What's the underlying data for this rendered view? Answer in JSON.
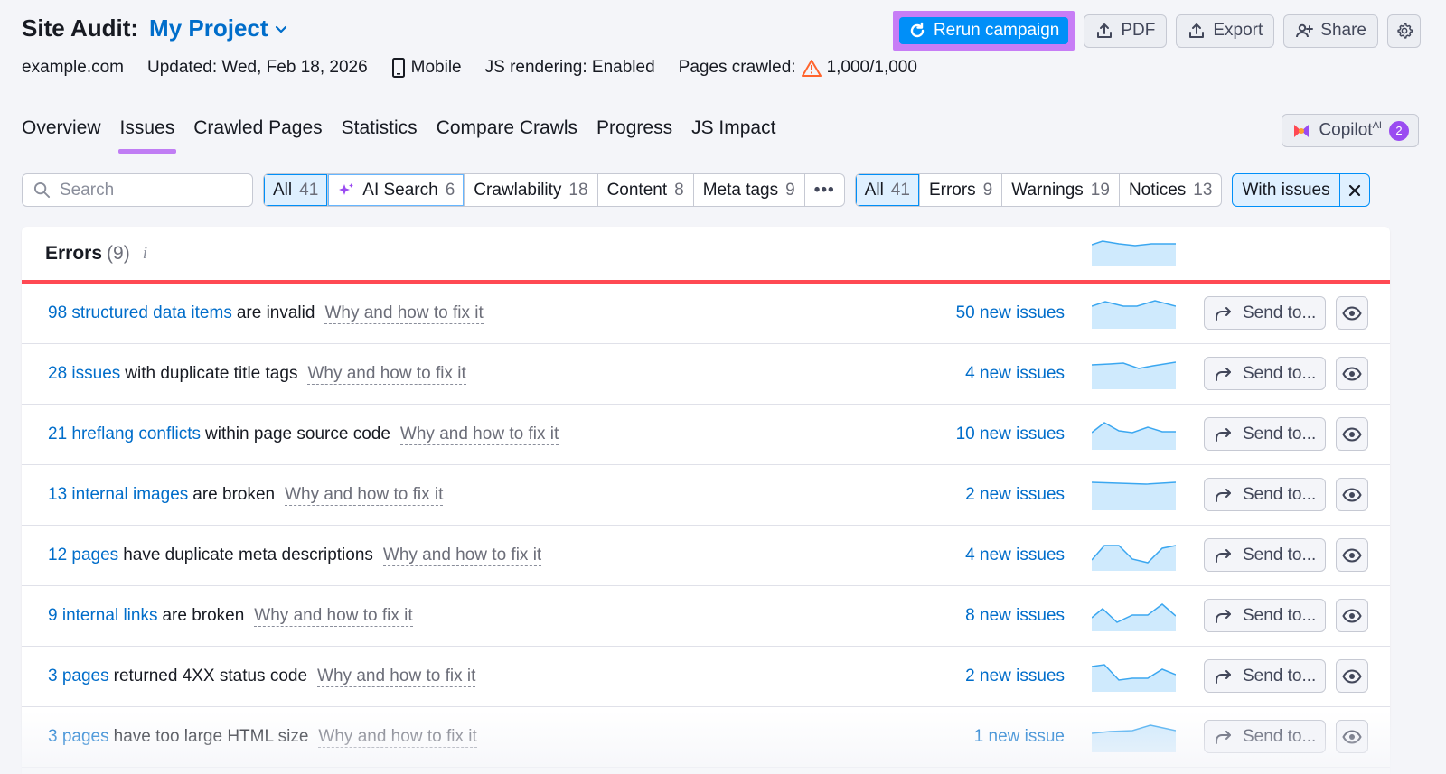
{
  "header": {
    "title_label": "Site Audit:",
    "project_name": "My Project",
    "domain": "example.com",
    "updated": "Updated: Wed, Feb 18, 2026",
    "device": "Mobile",
    "js_rendering": "JS rendering: Enabled",
    "pages_crawled_label": "Pages crawled:",
    "pages_crawled_value": "1,000/1,000"
  },
  "actions": {
    "rerun": "Rerun campaign",
    "pdf": "PDF",
    "export": "Export",
    "share": "Share"
  },
  "tabs": [
    "Overview",
    "Issues",
    "Crawled Pages",
    "Statistics",
    "Compare Crawls",
    "Progress",
    "JS Impact"
  ],
  "copilot": {
    "label": "Copilot",
    "sup": "AI",
    "count": "2"
  },
  "filters": {
    "search_placeholder": "Search",
    "categories": [
      {
        "label": "All",
        "count": "41"
      },
      {
        "label": "AI Search",
        "count": "6"
      },
      {
        "label": "Crawlability",
        "count": "18"
      },
      {
        "label": "Content",
        "count": "8"
      },
      {
        "label": "Meta tags",
        "count": "9"
      }
    ],
    "more": "•••",
    "severity": [
      {
        "label": "All",
        "count": "41"
      },
      {
        "label": "Errors",
        "count": "9"
      },
      {
        "label": "Warnings",
        "count": "19"
      },
      {
        "label": "Notices",
        "count": "13"
      }
    ],
    "with_issues": "With issues"
  },
  "errors": {
    "title": "Errors",
    "count": "(9)",
    "info": "i",
    "why": "Why and how to fix it",
    "send": "Send to...",
    "rows": [
      {
        "link": "98 structured data items",
        "text": "are invalid",
        "new": "50 new issues"
      },
      {
        "link": "28 issues",
        "text": "with duplicate title tags",
        "new": "4 new issues"
      },
      {
        "link": "21 hreflang conflicts",
        "text": "within page source code",
        "new": "10 new issues"
      },
      {
        "link": "13 internal images",
        "text": "are broken",
        "new": "2 new issues"
      },
      {
        "link": "12 pages",
        "text": "have duplicate meta descriptions",
        "new": "4 new issues"
      },
      {
        "link": "9 internal links",
        "text": "are broken",
        "new": "8 new issues"
      },
      {
        "link": "3 pages",
        "text": "returned 4XX status code",
        "new": "2 new issues"
      },
      {
        "link": "3 pages",
        "text": "have too large HTML size",
        "new": "1 new issue"
      }
    ]
  },
  "colors": {
    "accent": "#006dca",
    "primary_button": "#008ff8",
    "highlight": "#c77df6",
    "error_line": "#ff4953",
    "sparkline_fill": "#cfeafd",
    "sparkline_stroke": "#3ba7f0"
  }
}
